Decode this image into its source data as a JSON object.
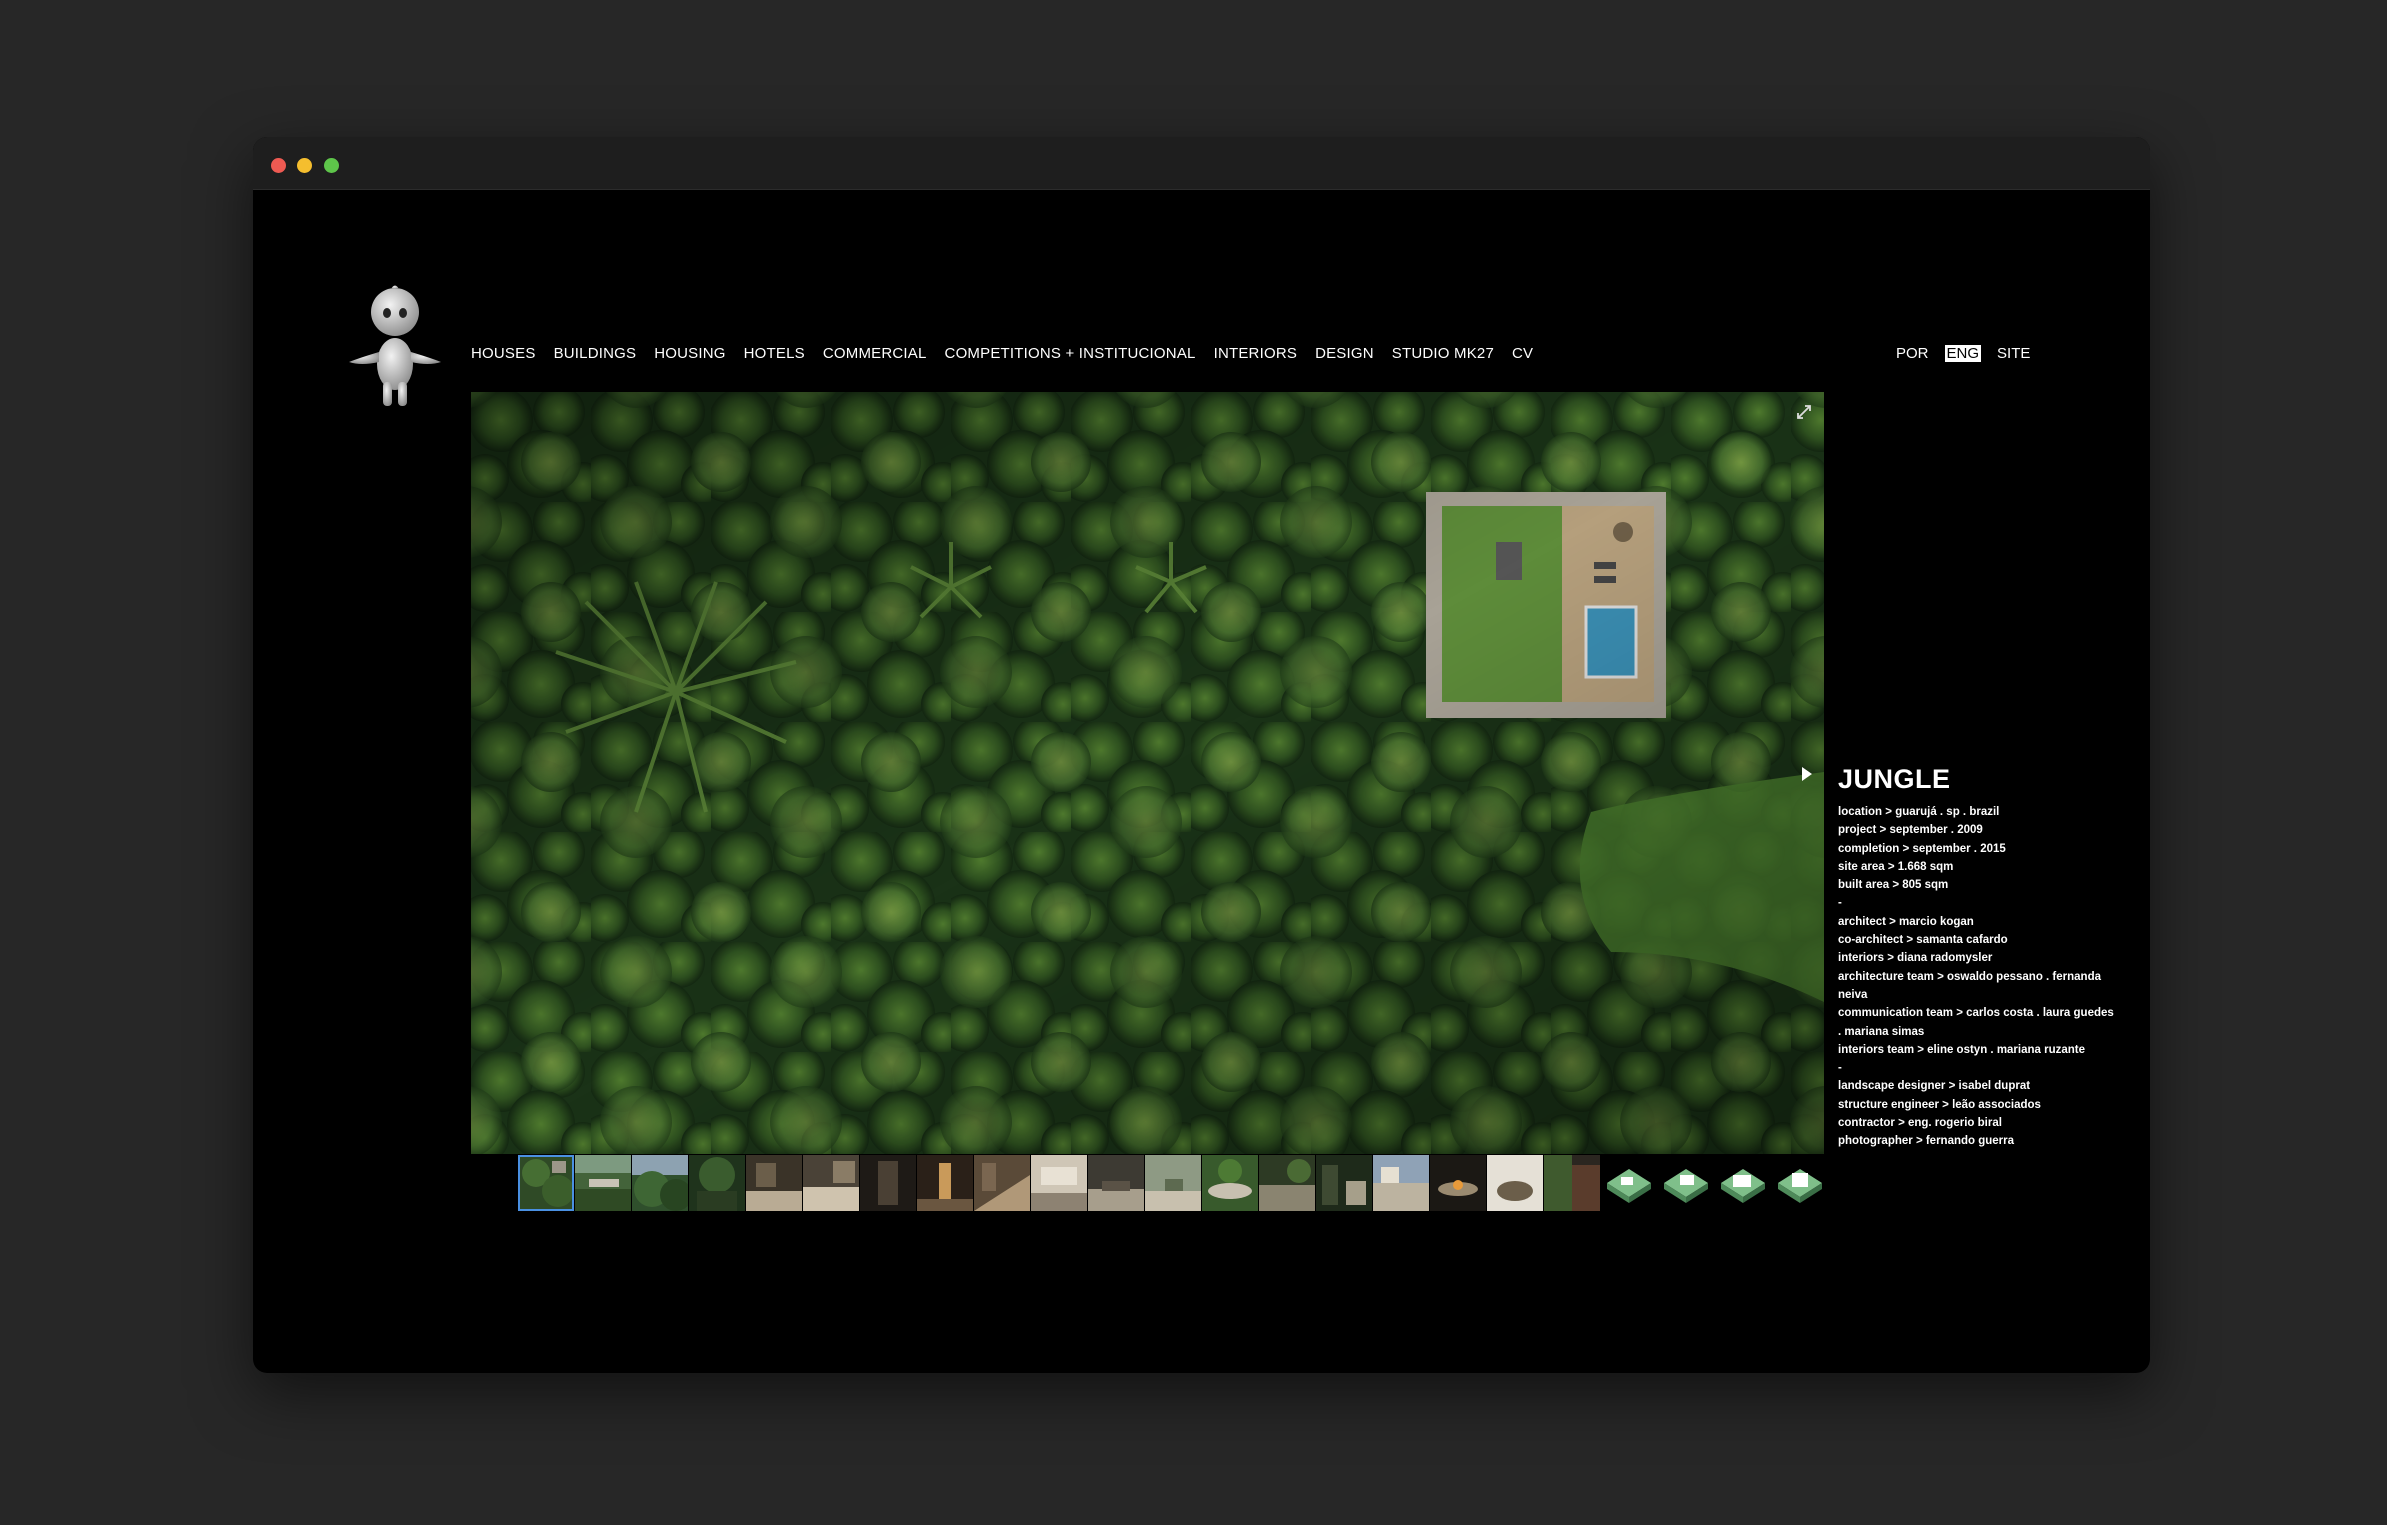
{
  "nav": {
    "items": [
      {
        "label": "HOUSES"
      },
      {
        "label": "BUILDINGS"
      },
      {
        "label": "HOUSING"
      },
      {
        "label": "HOTELS"
      },
      {
        "label": "COMMERCIAL"
      },
      {
        "label": "COMPETITIONS + INSTITUCIONAL"
      },
      {
        "label": "INTERIORS"
      },
      {
        "label": "DESIGN"
      },
      {
        "label": "STUDIO MK27"
      },
      {
        "label": "CV"
      }
    ]
  },
  "lang": {
    "por": "POR",
    "eng": "ENG",
    "site": "SITE"
  },
  "project": {
    "title": "JUNGLE",
    "lines": [
      "location > guarujá . sp . brazil",
      "project > september . 2009",
      "completion > september . 2015",
      "site area > 1.668 sqm",
      "built area > 805 sqm",
      "-",
      "architect > marcio kogan",
      "co-architect > samanta cafardo",
      "interiors > diana radomysler",
      "architecture team > oswaldo pessano . fernanda",
      "neiva",
      "communication team > carlos costa . laura guedes",
      ". mariana simas",
      "interiors team > eline ostyn . mariana ruzante",
      "-",
      "landscape designer > isabel duprat",
      "structure engineer > leão associados",
      "contractor > eng. rogerio biral",
      "photographer > fernando guerra"
    ]
  },
  "colors": {
    "selected_thumb": "#4a90e2",
    "background": "#000000",
    "desktop": "#272727"
  },
  "icons": {
    "expand": "expand-icon",
    "next": "play-right-icon"
  }
}
